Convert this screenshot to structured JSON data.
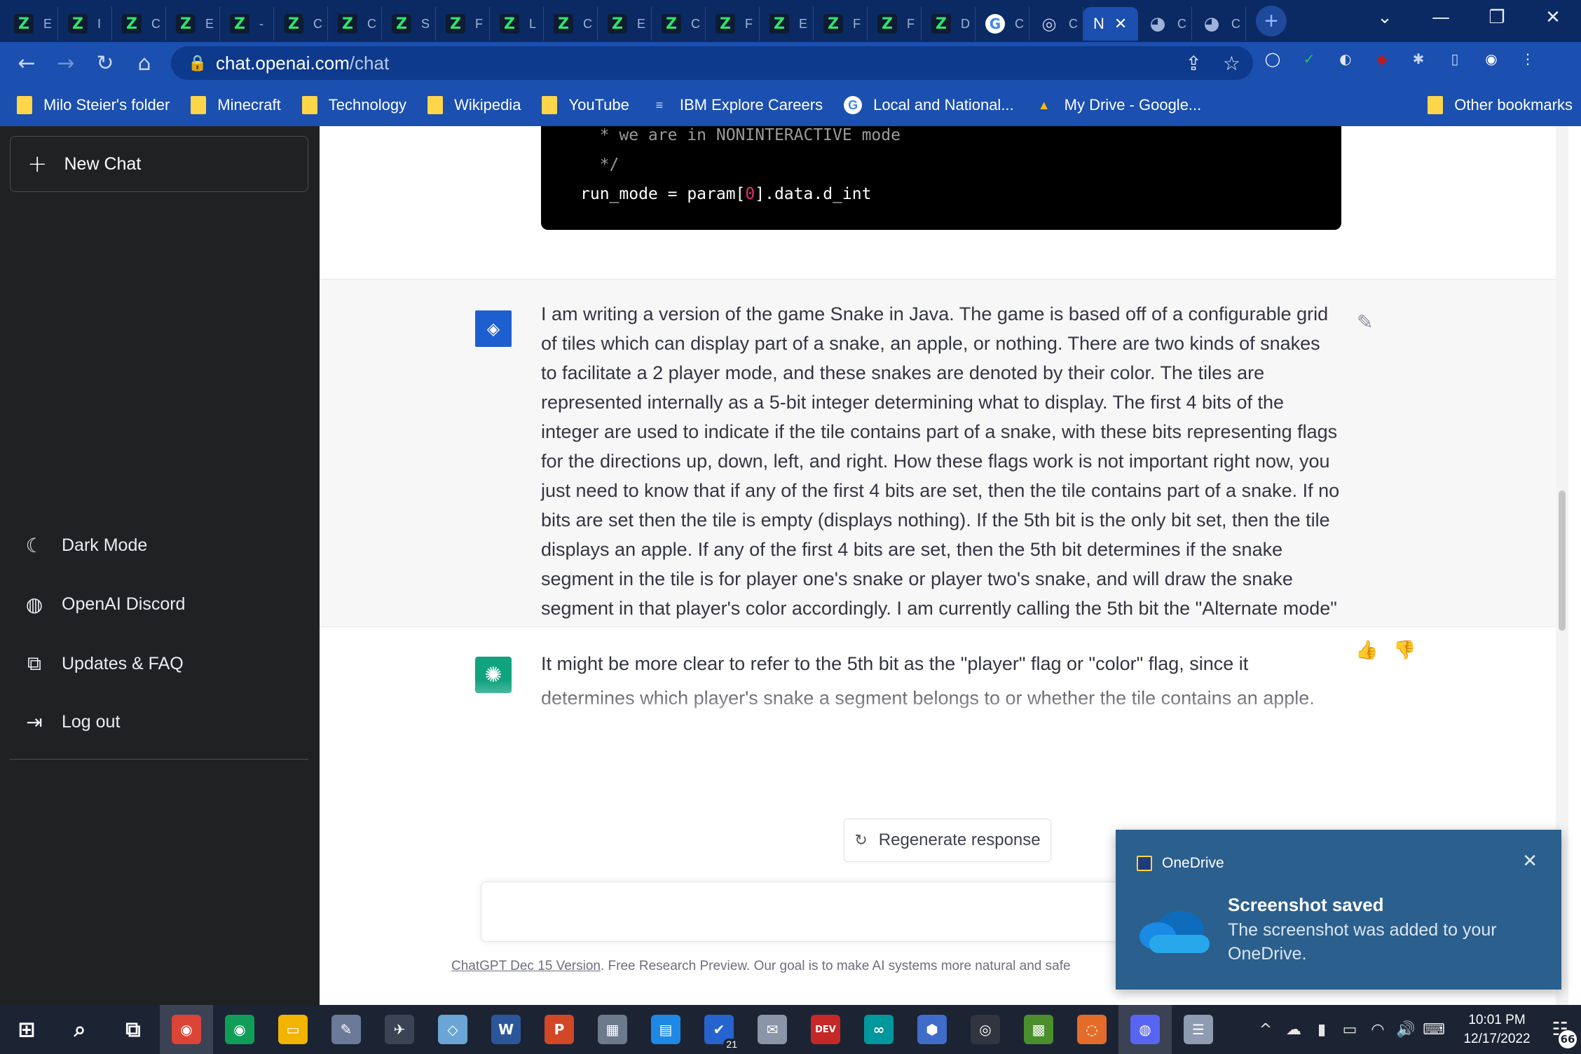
{
  "browser": {
    "tabs": [
      {
        "icon": "Z",
        "title": "E"
      },
      {
        "icon": "Z",
        "title": "I"
      },
      {
        "icon": "Z",
        "title": "C"
      },
      {
        "icon": "Z",
        "title": "E"
      },
      {
        "icon": "Z",
        "title": "-"
      },
      {
        "icon": "Z",
        "title": "C"
      },
      {
        "icon": "Z",
        "title": "C"
      },
      {
        "icon": "Z",
        "title": "S"
      },
      {
        "icon": "Z",
        "title": "F"
      },
      {
        "icon": "Z",
        "title": "L"
      },
      {
        "icon": "Z",
        "title": "C"
      },
      {
        "icon": "Z",
        "title": "E"
      },
      {
        "icon": "Z",
        "title": "C"
      },
      {
        "icon": "Z",
        "title": "F"
      },
      {
        "icon": "Z",
        "title": "E"
      },
      {
        "icon": "Z",
        "title": "F"
      },
      {
        "icon": "Z",
        "title": "F"
      },
      {
        "icon": "Z",
        "title": "D"
      },
      {
        "icon": "G",
        "title": "C"
      },
      {
        "icon": "◎",
        "title": "C"
      }
    ],
    "active_tab": {
      "title": "N",
      "close": "✕"
    },
    "trailing_tabs": [
      {
        "icon": "◕",
        "title": "C"
      },
      {
        "icon": "◕",
        "title": "C"
      }
    ],
    "new_tab": "+",
    "window_controls": {
      "dropdown": "⌄",
      "minimize": "—",
      "restore": "❐",
      "close": "✕"
    },
    "nav": {
      "back": "←",
      "forward": "→",
      "reload": "↻",
      "home": "⌂"
    },
    "url": {
      "lock": "🔒",
      "host": "chat.openai.com",
      "path": "/chat"
    },
    "omnibox_icons": {
      "share": "⇪",
      "star": "☆"
    },
    "extensions": [
      {
        "name": "ring-extension",
        "glyph": "◯",
        "color": "#ffffff"
      },
      {
        "name": "check-extension",
        "glyph": "✓",
        "color": "#22c55e"
      },
      {
        "name": "toggle-extension",
        "glyph": "◐",
        "color": "#e5e7eb"
      },
      {
        "name": "red-extension",
        "glyph": "◆",
        "color": "#b91c1c"
      },
      {
        "name": "puzzle-extension",
        "glyph": "✱",
        "color": "#c7d6f5"
      },
      {
        "name": "sidepanel",
        "glyph": "▯",
        "color": "#c7d6f5"
      },
      {
        "name": "profile",
        "glyph": "◉",
        "color": "#ffffff"
      },
      {
        "name": "menu",
        "glyph": "⋮",
        "color": "#ffffff"
      }
    ],
    "bookmarks": [
      {
        "label": "Milo Steier's folder",
        "type": "folder"
      },
      {
        "label": "Minecraft",
        "type": "folder"
      },
      {
        "label": "Technology",
        "type": "folder"
      },
      {
        "label": "Wikipedia",
        "type": "folder"
      },
      {
        "label": "YouTube",
        "type": "folder"
      },
      {
        "label": "IBM Explore Careers",
        "type": "ibm"
      },
      {
        "label": "Local and National...",
        "type": "google"
      },
      {
        "label": "My Drive - Google...",
        "type": "drive"
      }
    ],
    "other_bookmarks": "Other bookmarks"
  },
  "sidebar": {
    "new_chat": "New Chat",
    "links": [
      {
        "label": "Dark Mode",
        "icon": "☾"
      },
      {
        "label": "OpenAI Discord",
        "icon": "◍"
      },
      {
        "label": "Updates & FAQ",
        "icon": "⧉"
      },
      {
        "label": "Log out",
        "icon": "⇥"
      }
    ]
  },
  "chat": {
    "code_lines": [
      "  * we are in NONINTERACTIVE mode",
      "  */"
    ],
    "code_last": {
      "pre": "run_mode = param[",
      "num": "0",
      "post": "].data.d_int"
    },
    "user_avatar": "◈",
    "user_message": "I am writing a version of the game Snake in Java. The game is based off of a configurable grid of tiles which can display part of a snake, an apple, or nothing. There are two kinds of snakes to facilitate a 2 player mode, and these snakes are denoted by their color. The tiles are represented internally as a 5-bit integer determining what to display. The first 4 bits of the integer are used to indicate if the tile contains part of a snake, with these bits representing flags for the directions up, down, left, and right. How these flags work is not important right now, you just need to know that if any of the first 4 bits are set, then the tile contains part of a snake. If no bits are set then the tile is empty (displays nothing). If the 5th bit is the only bit set, then the tile displays an apple. If any of the first 4 bits are set, then the 5th bit determines if the snake segment in the tile is for player one's snake or player two's snake, and will draw the snake segment in that player's color accordingly. I am currently calling the 5th bit the \"Alternate mode\" flag, with player two's snake being the alternate mode for player one's snake, and apple tiles being the alternate mode for empty tiles. Is there a better name for the flag represented by the 5th bit, and if so, what? Or should it remain the \"alternate mode\" flag?",
    "edit_icon": "✎",
    "bot_avatar": "✺",
    "bot_message": "It might be more clear to refer to the 5th bit as the \"player\" flag or \"color\" flag, since it determines which player's snake a segment belongs to or whether the tile contains an apple.",
    "thumbs": {
      "up": "👍",
      "down": "👎"
    },
    "regenerate": "Regenerate response",
    "regenerate_icon": "↻",
    "footer_link": "ChatGPT Dec 15 Version",
    "footer_text": ". Free Research Preview. Our goal is to make AI systems more natural and safe"
  },
  "toast": {
    "app": "OneDrive",
    "close": "✕",
    "title": "Screenshot saved",
    "body": "The screenshot was added to your OneDrive."
  },
  "taskbar": {
    "apps": [
      {
        "name": "windows-start",
        "glyph": "⊞",
        "bg": "transparent"
      },
      {
        "name": "search",
        "glyph": "⌕",
        "bg": "transparent"
      },
      {
        "name": "task-view",
        "glyph": "⧉",
        "bg": "transparent"
      },
      {
        "name": "chrome-profile-1",
        "glyph": "◉",
        "bg": "#db4437",
        "active": true
      },
      {
        "name": "chrome-profile-2",
        "glyph": "◉",
        "bg": "#0f9d58"
      },
      {
        "name": "file-explorer",
        "glyph": "▭",
        "bg": "#f2b400"
      },
      {
        "name": "paint",
        "glyph": "✎",
        "bg": "#6b7a99"
      },
      {
        "name": "app-tool",
        "glyph": "✈",
        "bg": "#3b4455"
      },
      {
        "name": "notes",
        "glyph": "◇",
        "bg": "#6aa5d6"
      },
      {
        "name": "word",
        "glyph": "W",
        "bg": "#2b579a"
      },
      {
        "name": "powerpoint",
        "glyph": "P",
        "bg": "#d24726"
      },
      {
        "name": "calculator",
        "glyph": "▦",
        "bg": "#6d7a8c"
      },
      {
        "name": "calendar",
        "glyph": "▤",
        "bg": "#1e88e5"
      },
      {
        "name": "todo",
        "glyph": "✔",
        "bg": "#2564cf",
        "badge": "21"
      },
      {
        "name": "mail",
        "glyph": "✉",
        "bg": "#8a96a8"
      },
      {
        "name": "dev-cpp",
        "glyph": "DEV",
        "bg": "#c62828"
      },
      {
        "name": "arduino",
        "glyph": "∞",
        "bg": "#00979d"
      },
      {
        "name": "cube-app",
        "glyph": "⬢",
        "bg": "#3f6cc9"
      },
      {
        "name": "obs",
        "glyph": "◎",
        "bg": "#30353f"
      },
      {
        "name": "minecraft",
        "glyph": "▩",
        "bg": "#4a8f2c"
      },
      {
        "name": "orbit-app",
        "glyph": "◌",
        "bg": "#e46c2a"
      },
      {
        "name": "discord",
        "glyph": "◍",
        "bg": "#5865f2",
        "active": true
      },
      {
        "name": "notepad",
        "glyph": "☰",
        "bg": "#8e9bb0"
      }
    ],
    "tray": [
      "^",
      "☁",
      "▮",
      "▭",
      "◠",
      "🔊",
      "⌨"
    ],
    "time": "10:01 PM",
    "date": "12/17/2022",
    "notifications": "66"
  }
}
